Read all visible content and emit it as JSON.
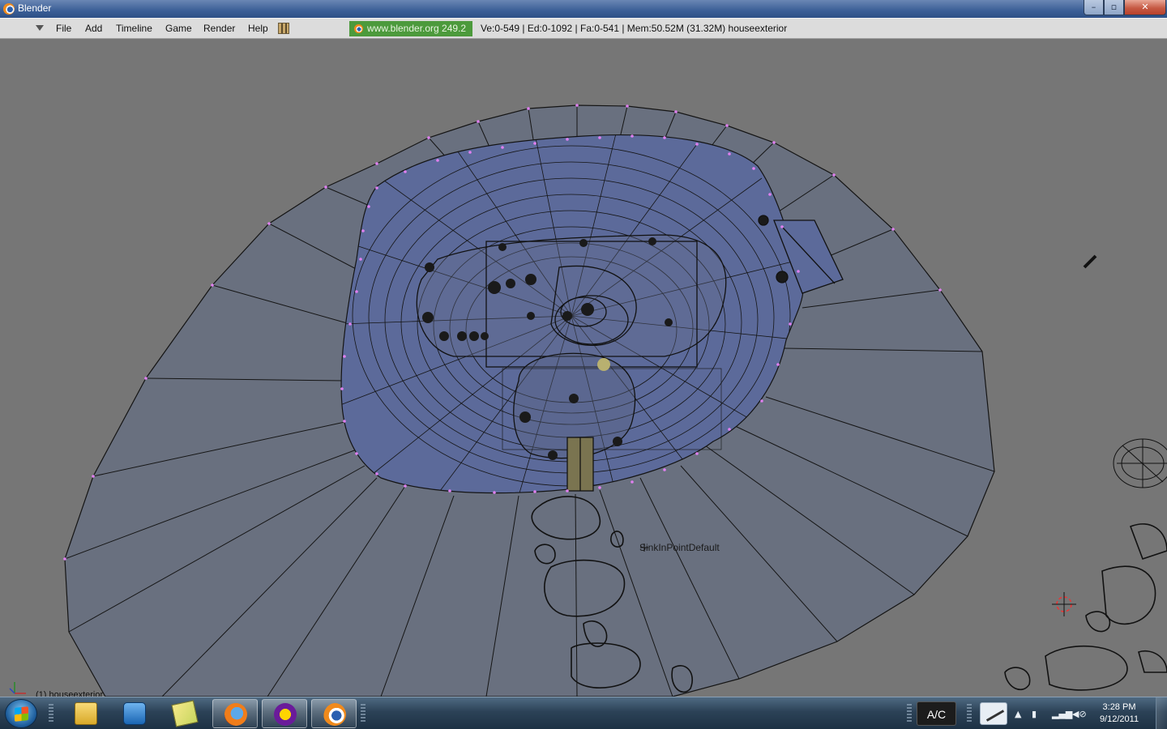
{
  "window": {
    "title": "Blender",
    "controls": {
      "minimize": "–",
      "maximize": "▫",
      "close": "✕"
    }
  },
  "header": {
    "menus": [
      "File",
      "Add",
      "Timeline",
      "Game",
      "Render",
      "Help"
    ],
    "link_label": "www.blender.org 249.2",
    "stats": "Ve:0-549 | Ed:0-1092 | Fa:0-541 | Mem:50.52M (31.32M) houseexterior"
  },
  "viewport": {
    "empty_label": "SinkInPointDefault",
    "object_label": "(1) houseexterior"
  },
  "taskbar": {
    "pinned": [
      {
        "name": "explorer",
        "icon": "folder-icon"
      },
      {
        "name": "media-player",
        "icon": "media-player-icon"
      },
      {
        "name": "sticky-notes",
        "icon": "sticky-notes-icon"
      },
      {
        "name": "firefox",
        "icon": "firefox-icon"
      },
      {
        "name": "yahoo-messenger",
        "icon": "yahoo-messenger-icon"
      },
      {
        "name": "blender",
        "icon": "blender-icon",
        "active": true
      }
    ],
    "ac_label": "A/C",
    "tray_expand": "▲",
    "clock": {
      "time": "3:28 PM",
      "date": "9/12/2011"
    }
  },
  "colors": {
    "viewport_bg": "#767676",
    "terrain_fill": "#69707f",
    "wall_fill": "#5c6a9a",
    "wire": "#141414",
    "vertex": "#e080f0",
    "link_bg": "#4c9a3c"
  }
}
